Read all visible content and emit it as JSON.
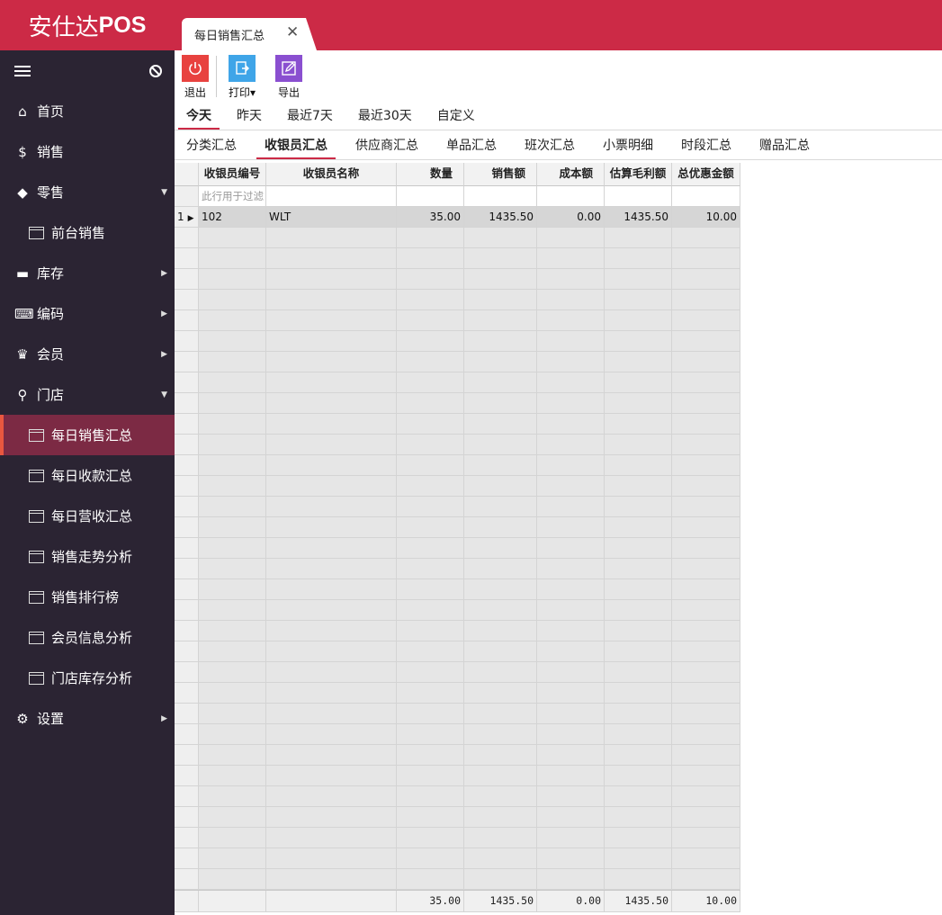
{
  "app": {
    "brand_cn": "安仕达",
    "brand_en": "POS"
  },
  "doc_tab": {
    "label": "每日销售汇总",
    "close": "✕"
  },
  "sidebar": {
    "items": [
      {
        "label": "首页",
        "icon": "home-icon",
        "glyph": "⌂"
      },
      {
        "label": "销售",
        "icon": "dollar-icon",
        "glyph": "$"
      },
      {
        "label": "零售",
        "icon": "tag-icon",
        "glyph": "◆",
        "arrow": "▼"
      },
      {
        "label": "前台销售",
        "sub": true
      },
      {
        "label": "库存",
        "icon": "archive-icon",
        "glyph": "▬",
        "arrow": "▶"
      },
      {
        "label": "编码",
        "icon": "code-icon",
        "glyph": "⌨",
        "arrow": "▶"
      },
      {
        "label": "会员",
        "icon": "crown-icon",
        "glyph": "♛",
        "arrow": "▶"
      },
      {
        "label": "门店",
        "icon": "search-icon",
        "glyph": "⚲",
        "arrow": "▼"
      },
      {
        "label": "每日销售汇总",
        "sub": true,
        "active": true
      },
      {
        "label": "每日收款汇总",
        "sub": true
      },
      {
        "label": "每日营收汇总",
        "sub": true
      },
      {
        "label": "销售走势分析",
        "sub": true
      },
      {
        "label": "销售排行榜",
        "sub": true
      },
      {
        "label": "会员信息分析",
        "sub": true
      },
      {
        "label": "门店库存分析",
        "sub": true
      },
      {
        "label": "设置",
        "icon": "gear-icon",
        "glyph": "⚙",
        "arrow": "▶"
      }
    ]
  },
  "toolbar": {
    "exit_label": "退出",
    "print_label": "打印",
    "print_arrow": "▾",
    "export_label": "导出"
  },
  "period_tabs": [
    "今天",
    "昨天",
    "最近7天",
    "最近30天",
    "自定义"
  ],
  "report_tabs": [
    "分类汇总",
    "收银员汇总",
    "供应商汇总",
    "单品汇总",
    "班次汇总",
    "小票明细",
    "时段汇总",
    "赠品汇总"
  ],
  "table": {
    "columns": [
      "收银员编号",
      "收银员名称",
      "数量",
      "销售额",
      "成本额",
      "估算毛利额",
      "总优惠金额"
    ],
    "filter_placeholder": "此行用于过滤",
    "rows": [
      {
        "row_no": "1",
        "marker": "▶",
        "cells": [
          "102",
          "WLT",
          "35.00",
          "1435.50",
          "0.00",
          "1435.50",
          "10.00"
        ]
      }
    ],
    "totals": [
      "",
      "",
      "35.00",
      "1435.50",
      "0.00",
      "1435.50",
      "10.00"
    ]
  },
  "colors": {
    "brand": "#cc2a46",
    "sidebar": "#2b2433",
    "active_item": "#7c2a44",
    "exit_button": "#e8423f",
    "print_button": "#3fa5e8",
    "export_button": "#8a4fd0"
  }
}
